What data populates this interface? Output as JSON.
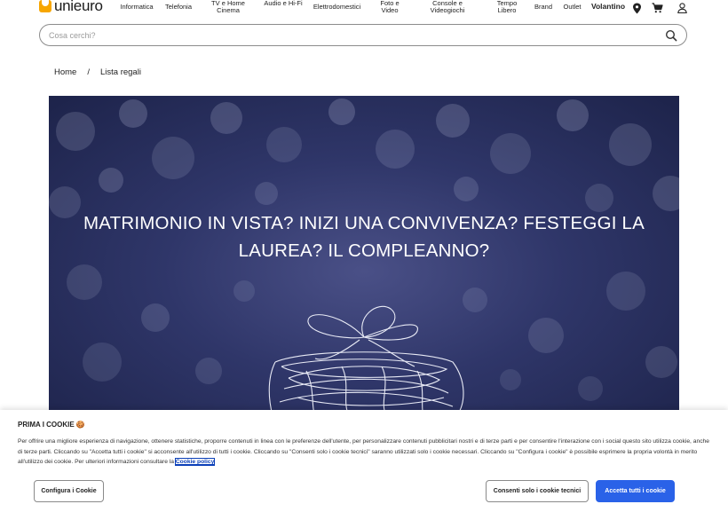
{
  "header": {
    "logo_text": "unieuro",
    "nav": [
      {
        "label": "Informatica"
      },
      {
        "label": "Telefonia"
      },
      {
        "label": "TV e Home Cinema"
      },
      {
        "label": "Audio e Hi-Fi"
      },
      {
        "label": "Elettrodomestici"
      },
      {
        "label": "Foto e Video"
      },
      {
        "label": "Console e Videogiochi"
      },
      {
        "label": "Tempo Libero"
      },
      {
        "label": "Brand"
      },
      {
        "label": "Outlet"
      },
      {
        "label": "Volantino"
      }
    ],
    "icons": [
      "location-pin-icon",
      "cart-icon",
      "user-icon"
    ]
  },
  "search": {
    "placeholder": "Cosa cerchi?"
  },
  "breadcrumb": {
    "home": "Home",
    "separator": "/",
    "current": "Lista regali"
  },
  "hero": {
    "title": "MATRIMONIO IN VISTA? INIZI UNA CONVIVENZA? FESTEGGI LA LAUREA? IL COMPLEANNO?"
  },
  "cookie": {
    "title": "PRIMA I COOKIE 🍪",
    "text": "Per offrire una migliore esperienza di navigazione, ottenere statistiche, proporre contenuti in linea con le preferenze dell'utente, per personalizzare contenuti pubblicitari nostri e di terze parti e per consentire l'interazione con i social questo sito utilizza cookie, anche di terze parti. Cliccando su \"Accetta tutti i cookie\" si acconsente all'utilizzo di tutti i cookie. Cliccando su \"Consenti solo i cookie tecnici\" saranno utilizzati solo i cookie necessari. Cliccando su \"Configura i cookie\" è possibile esprimere la propria volontà in merito all'utilizzo dei cookie. Per ulteriori informazioni consultare la",
    "link": "Cookie policy",
    "configure_label": "Configura i Cookie",
    "technical_label": "Consenti solo i cookie tecnici",
    "accept_label": "Accetta tutti i cookie"
  },
  "colors": {
    "accent": "#2a62e8",
    "brand": "#f7a600",
    "hero_bg": "#2f3669"
  }
}
